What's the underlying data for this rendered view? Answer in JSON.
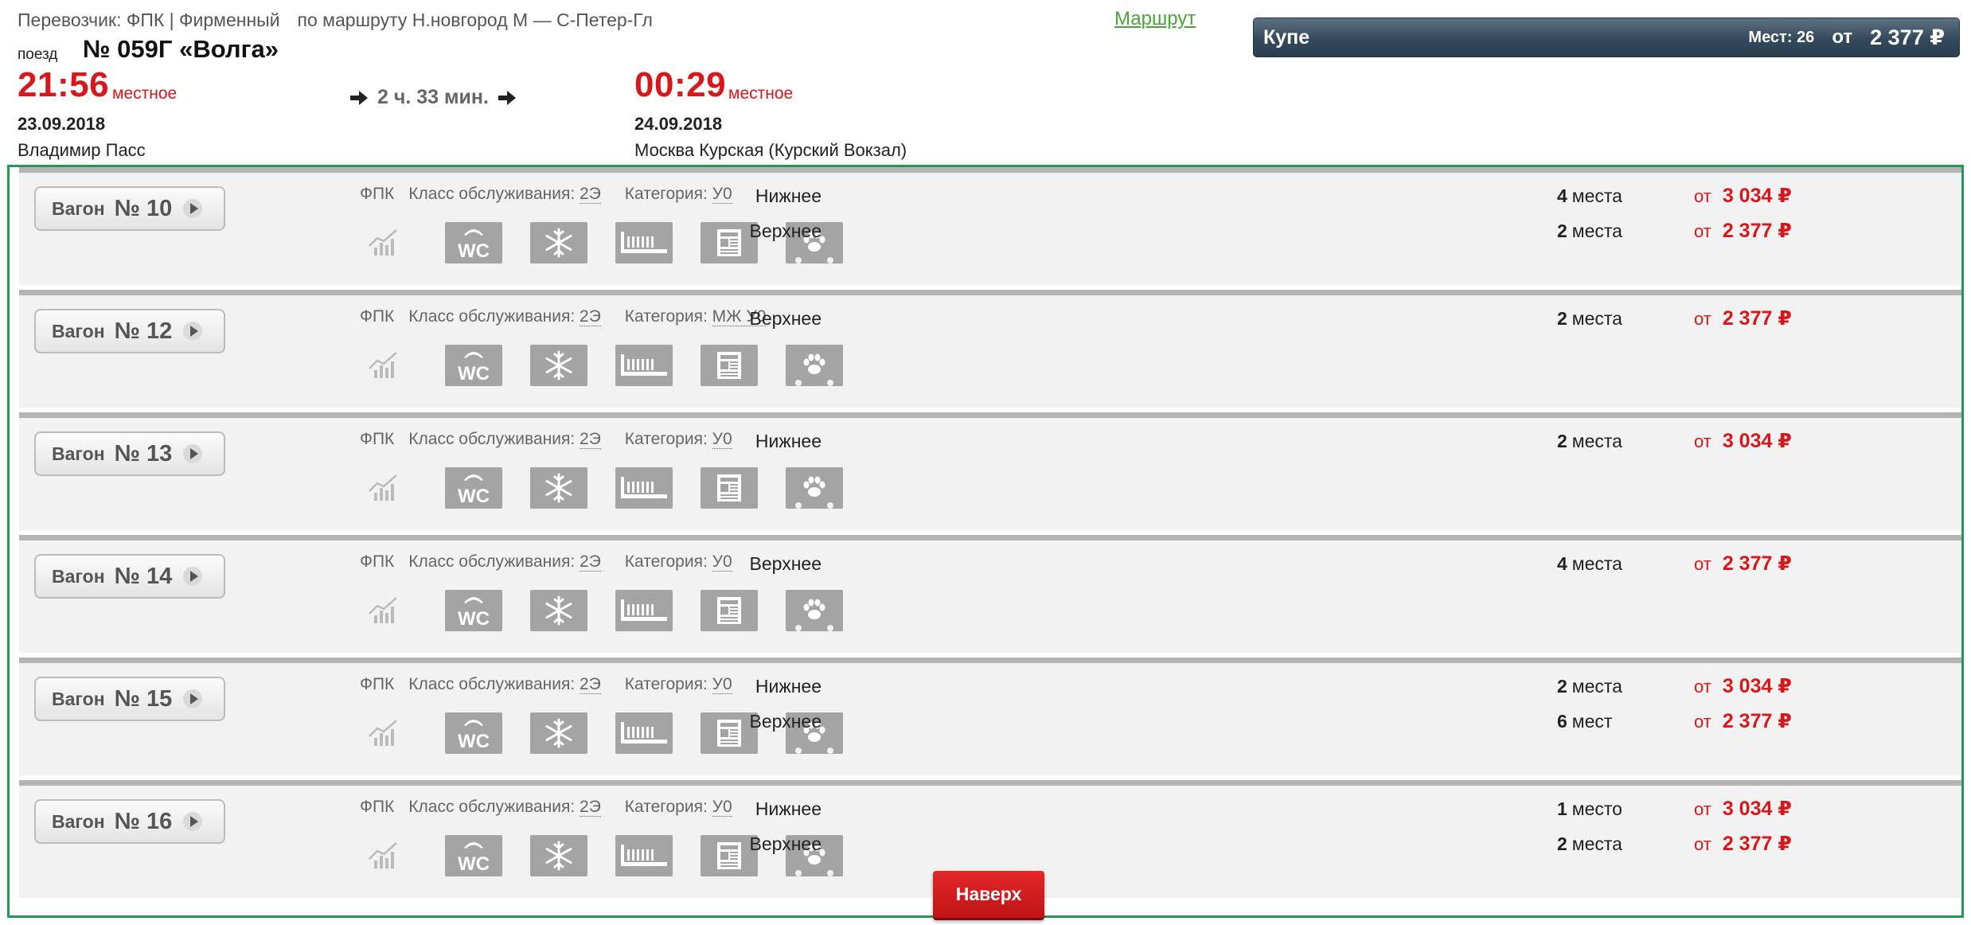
{
  "header": {
    "carrier": "Перевозчик: ФПК | Фирменный",
    "route_text": "по маршруту Н.новгород М — С-Петер-Гл",
    "route_link": "Маршрут",
    "train_prefix": "поезд",
    "train_name": "№ 059Г «Волга»",
    "departure": {
      "time": "21:56",
      "time_suffix": "местное",
      "date": "23.09.2018",
      "station": "Владимир Пасс"
    },
    "duration": "2 ч. 33 мин.",
    "arrival": {
      "time": "00:29",
      "time_suffix": "местное",
      "date": "24.09.2018",
      "station": "Москва Курская (Курский Вокзал)"
    }
  },
  "class_bar": {
    "name": "Купе",
    "seats": "Мест: 26",
    "from": "от",
    "price": "2 377 ₽"
  },
  "labels": {
    "wagon": "Вагон",
    "carrier": "ФПК",
    "service_class": "Класс обслуживания:",
    "category": "Категория:",
    "from": "от",
    "back_to_top": "Наверх"
  },
  "icons": [
    "rating-icon",
    "wc-icon",
    "air-conditioning-icon",
    "toothbrush-kit-icon",
    "newspaper-icon",
    "pets-icon"
  ],
  "colors": {
    "accent_red": "#d9161a",
    "link_green": "#4aa43a",
    "border_green": "#1f9a52",
    "class_bar": "#34495c"
  },
  "wagons": [
    {
      "number": "№ 10",
      "service_class": "2Э",
      "category": "У0",
      "seats": [
        {
          "type": "Нижнее",
          "count": "4",
          "unit": "места",
          "price": "3 034 ₽"
        },
        {
          "type": "Верхнее",
          "count": "2",
          "unit": "места",
          "price": "2 377 ₽"
        }
      ]
    },
    {
      "number": "№ 12",
      "service_class": "2Э",
      "category": "МЖ У0",
      "seats": [
        {
          "type": "Верхнее",
          "count": "2",
          "unit": "места",
          "price": "2 377 ₽"
        }
      ]
    },
    {
      "number": "№ 13",
      "service_class": "2Э",
      "category": "У0",
      "seats": [
        {
          "type": "Нижнее",
          "count": "2",
          "unit": "места",
          "price": "3 034 ₽"
        }
      ]
    },
    {
      "number": "№ 14",
      "service_class": "2Э",
      "category": "У0",
      "seats": [
        {
          "type": "Верхнее",
          "count": "4",
          "unit": "места",
          "price": "2 377 ₽"
        }
      ]
    },
    {
      "number": "№ 15",
      "service_class": "2Э",
      "category": "У0",
      "seats": [
        {
          "type": "Нижнее",
          "count": "2",
          "unit": "места",
          "price": "3 034 ₽"
        },
        {
          "type": "Верхнее",
          "count": "6",
          "unit": "мест",
          "price": "2 377 ₽"
        }
      ]
    },
    {
      "number": "№ 16",
      "service_class": "2Э",
      "category": "У0",
      "seats": [
        {
          "type": "Нижнее",
          "count": "1",
          "unit": "место",
          "price": "3 034 ₽"
        },
        {
          "type": "Верхнее",
          "count": "2",
          "unit": "места",
          "price": "2 377 ₽"
        }
      ]
    }
  ]
}
